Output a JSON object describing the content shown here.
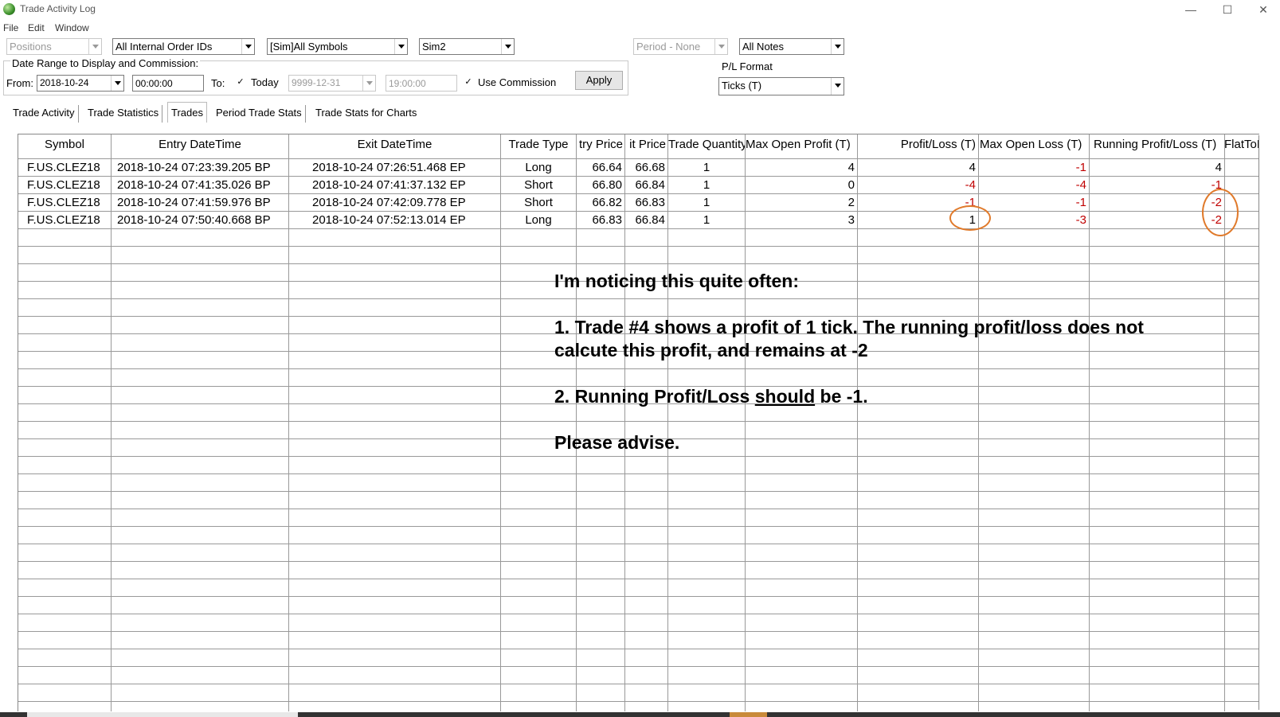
{
  "window": {
    "title": "Trade Activity Log",
    "minimize": "—",
    "maximize": "☐",
    "close": "✕"
  },
  "menu": [
    "File",
    "Edit",
    "Window"
  ],
  "filters": {
    "positions": "Positions",
    "order_ids": "All Internal Order IDs",
    "symbols": "[Sim]All Symbols",
    "account": "Sim2",
    "period": "Period - None",
    "notes": "All Notes",
    "pl_format_label": "P/L Format",
    "pl_format": "Ticks (T)"
  },
  "date_range": {
    "title": "Date Range to Display and Commission:",
    "from_label": "From:",
    "from_date": "2018-10-24",
    "from_time": "00:00:00",
    "to_label": "To:",
    "today_checked": "✓",
    "today_label": "Today",
    "to_date": "9999-12-31",
    "to_time": "19:00:00",
    "use_commission_checked": "✓",
    "use_commission_label": "Use Commission",
    "apply_label": "Apply"
  },
  "tabs": [
    "Trade Activity",
    "Trade Statistics",
    "Trades",
    "Period Trade Stats",
    "Trade Stats for Charts"
  ],
  "active_tab": "Trades",
  "table": {
    "headers": [
      "Symbol",
      "Entry DateTime",
      "Exit DateTime",
      "Trade Type",
      "try Price",
      "it Price",
      "Trade Quantity",
      "Max Open Profit (T)",
      "Profit/Loss (T)",
      "Max Open Loss (T)",
      "Running Profit/Loss (T)",
      "FlatToF"
    ],
    "rows": [
      [
        "F.US.CLEZ18",
        "2018-10-24  07:23:39.205 BP",
        "2018-10-24  07:26:51.468 EP",
        "Long",
        "66.64",
        "66.68",
        "1",
        "4",
        "4",
        "-1",
        "4",
        ""
      ],
      [
        "F.US.CLEZ18",
        "2018-10-24  07:41:35.026 BP",
        "2018-10-24  07:41:37.132 EP",
        "Short",
        "66.80",
        "66.84",
        "1",
        "0",
        "-4",
        "-4",
        "-1",
        ""
      ],
      [
        "F.US.CLEZ18",
        "2018-10-24  07:41:59.976 BP",
        "2018-10-24  07:42:09.778 EP",
        "Short",
        "66.82",
        "66.83",
        "1",
        "2",
        "-1",
        "-1",
        "-2",
        ""
      ],
      [
        "F.US.CLEZ18",
        "2018-10-24  07:50:40.668 BP",
        "2018-10-24  07:52:13.014 EP",
        "Long",
        "66.83",
        "66.84",
        "1",
        "3",
        "1",
        "-3",
        "-2",
        ""
      ]
    ]
  },
  "annotation": {
    "line1": "I'm noticing this quite often:",
    "line2": "1. Trade #4 shows a profit of 1 tick. The running profit/loss does not",
    "line3": "calcute this profit, and remains at -2",
    "line4_pre": "2. Running Profit/Loss ",
    "line4_under": "should",
    "line4_post": " be -1.",
    "line5": "Please advise."
  },
  "colors": {
    "negative": "#c00000",
    "circle": "#e07a2b"
  }
}
